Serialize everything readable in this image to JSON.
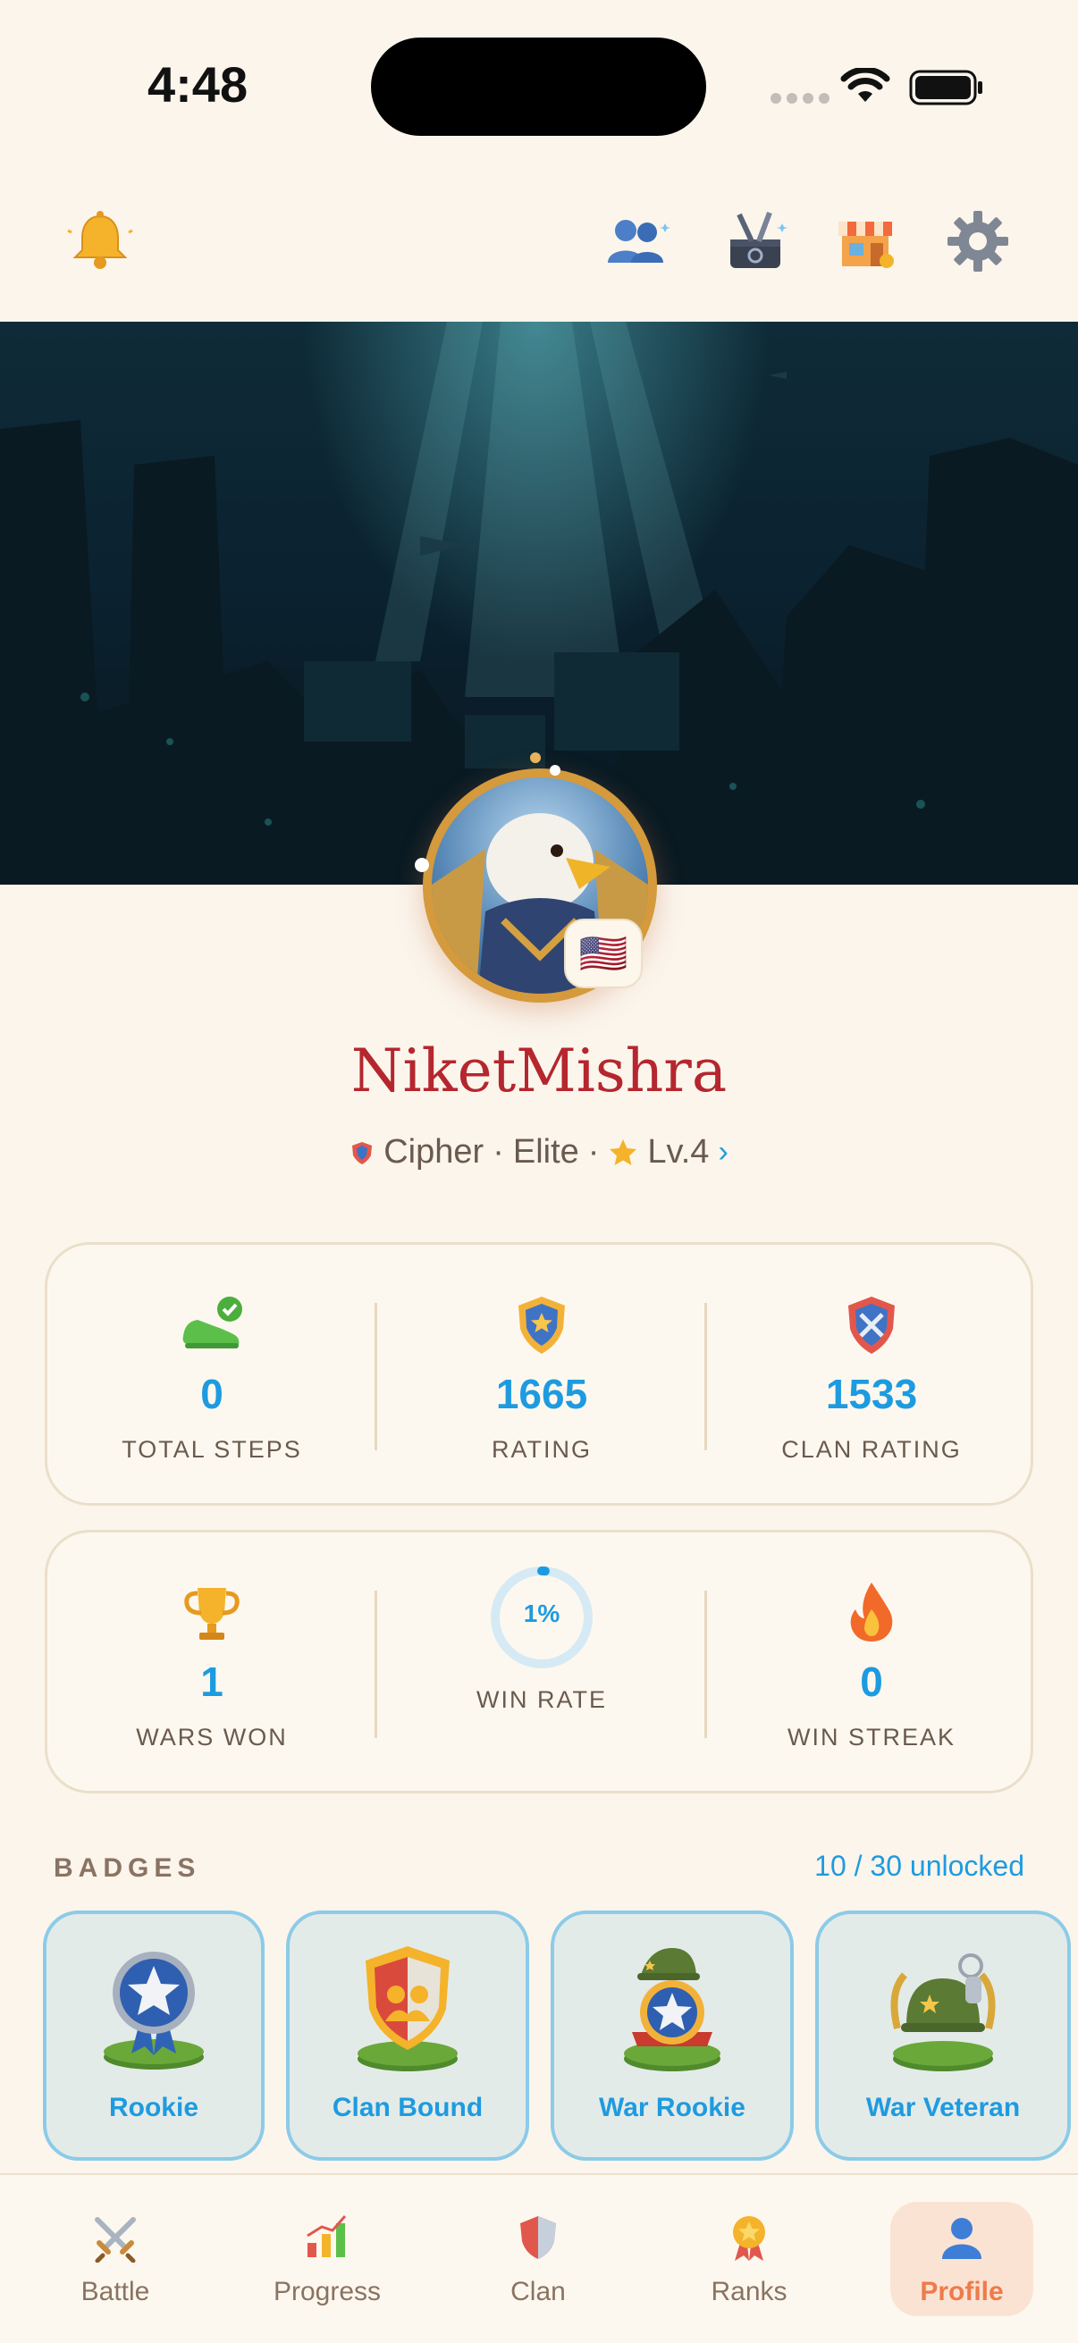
{
  "status_bar": {
    "time": "4:48"
  },
  "top_icons": [
    "bell-icon",
    "friends-icon",
    "toolbox-icon",
    "shop-icon",
    "settings-icon"
  ],
  "profile": {
    "username": "NiketMishra",
    "clan": "Cipher",
    "rank": "Elite",
    "level": "Lv.4",
    "separator": "·",
    "chevron": "›",
    "flag": "🇺🇸"
  },
  "stats_row1": [
    {
      "icon": "shoe-check-icon",
      "value": "0",
      "label": "TOTAL STEPS"
    },
    {
      "icon": "shield-star-icon",
      "value": "1665",
      "label": "RATING"
    },
    {
      "icon": "clan-shield-icon",
      "value": "1533",
      "label": "CLAN RATING"
    }
  ],
  "stats_row2": [
    {
      "icon": "trophy-icon",
      "value": "1",
      "label": "WARS WON"
    },
    {
      "icon": "progress-ring",
      "value": "1%",
      "label": "WIN RATE",
      "percent": 1
    },
    {
      "icon": "fire-icon",
      "value": "0",
      "label": "WIN STREAK"
    }
  ],
  "badges": {
    "title": "BADGES",
    "count": "10 / 30 unlocked",
    "items": [
      {
        "name": "Rookie",
        "icon": "rookie-medal-icon"
      },
      {
        "name": "Clan Bound",
        "icon": "clan-bound-shield-icon"
      },
      {
        "name": "War Rookie",
        "icon": "war-rookie-helmet-icon"
      },
      {
        "name": "War Veteran",
        "icon": "war-veteran-helmet-icon"
      }
    ]
  },
  "nav": [
    {
      "label": "Battle",
      "icon": "crossed-swords-icon",
      "active": false
    },
    {
      "label": "Progress",
      "icon": "bar-chart-icon",
      "active": false
    },
    {
      "label": "Clan",
      "icon": "shield-icon",
      "active": false
    },
    {
      "label": "Ranks",
      "icon": "medal-icon",
      "active": false
    },
    {
      "label": "Profile",
      "icon": "person-icon",
      "active": true
    }
  ],
  "colors": {
    "accent": "#1e9be0",
    "username": "#b5262e",
    "active_nav": "#ef7a4a",
    "background": "#fbf5ec"
  }
}
